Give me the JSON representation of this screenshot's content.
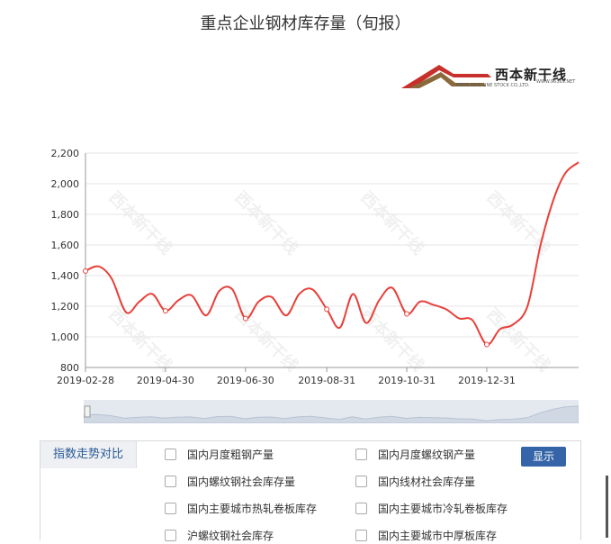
{
  "page": {
    "title": "重点企业钢材库存量（旬报）",
    "logo_text": "西本新干线",
    "logo_subtitle": "XIBEN NEW LINE STOCK CO.,LTD.",
    "logo_site": "WWW.96369.NET",
    "watermark_text": "西本新干线"
  },
  "chart_data": {
    "type": "line",
    "title": "",
    "xlabel": "",
    "ylabel": "",
    "ylim": [
      800,
      2200
    ],
    "yticks": [
      800,
      1000,
      1200,
      1400,
      1600,
      1800,
      2000,
      2200
    ],
    "ytick_labels": [
      "800",
      "1,000",
      "1,200",
      "1,400",
      "1,600",
      "1,800",
      "2,000",
      "2,200"
    ],
    "xlim": [
      "2019-02-28",
      "2020-03-10"
    ],
    "xtick_labels": [
      "2019-02-28",
      "2019-04-30",
      "2019-06-30",
      "2019-08-31",
      "2019-10-31",
      "2019-12-31"
    ],
    "grid": "horizontal",
    "line_color": "#e8403a",
    "series": [
      {
        "x": [
          "2019-02-28",
          "2019-03-10",
          "2019-03-20",
          "2019-03-31",
          "2019-04-10",
          "2019-04-20",
          "2019-04-30",
          "2019-05-10",
          "2019-05-20",
          "2019-05-31",
          "2019-06-10",
          "2019-06-20",
          "2019-06-30",
          "2019-07-10",
          "2019-07-20",
          "2019-07-31",
          "2019-08-10",
          "2019-08-20",
          "2019-08-31",
          "2019-09-10",
          "2019-09-20",
          "2019-09-30",
          "2019-10-10",
          "2019-10-20",
          "2019-10-31",
          "2019-11-10",
          "2019-11-20",
          "2019-11-30",
          "2019-12-10",
          "2019-12-20",
          "2019-12-31",
          "2020-01-10",
          "2020-01-20",
          "2020-01-31",
          "2020-02-10",
          "2020-02-20",
          "2020-02-29",
          "2020-03-10"
        ],
        "values": [
          1430,
          1460,
          1380,
          1160,
          1230,
          1280,
          1170,
          1240,
          1270,
          1140,
          1300,
          1310,
          1120,
          1230,
          1260,
          1140,
          1280,
          1310,
          1180,
          1060,
          1280,
          1090,
          1240,
          1320,
          1150,
          1230,
          1210,
          1180,
          1120,
          1110,
          950,
          1050,
          1080,
          1200,
          1600,
          1900,
          2070,
          2140
        ],
        "marked_points": [
          0,
          6,
          12,
          18,
          24,
          30
        ]
      }
    ]
  },
  "panel": {
    "tab_label": "指数走势对比",
    "options": [
      "国内月度粗钢产量",
      "国内月度螺纹钢产量",
      "国内螺纹钢社会库存量",
      "国内线材社会库存量",
      "国内主要城市热轧卷板库存",
      "国内主要城市冷轧卷板库存",
      "沪螺纹钢社会库存",
      "国内主要城市中厚板库存"
    ],
    "button_label": "显示"
  }
}
